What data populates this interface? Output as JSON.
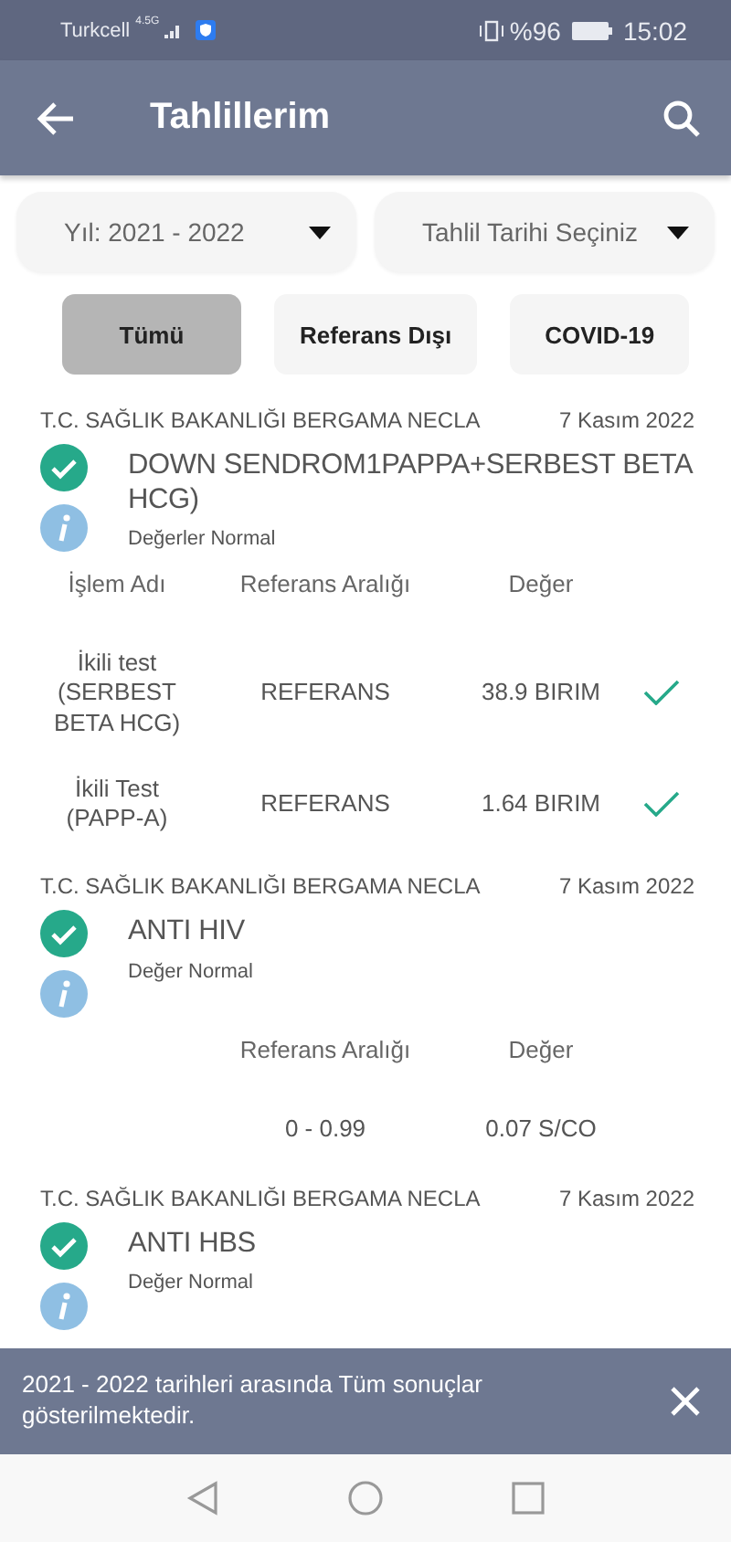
{
  "status_bar": {
    "carrier": "Turkcell",
    "network": "4.5G",
    "battery": "%96",
    "time": "15:02"
  },
  "app_bar": {
    "title": "Tahlillerim"
  },
  "filters": [
    {
      "label": "Yıl: 2021 - 2022"
    },
    {
      "label": "Tahlil Tarihi Seçiniz"
    }
  ],
  "tabs": [
    {
      "label": "Tümü",
      "selected": true
    },
    {
      "label": "Referans Dışı",
      "selected": false
    },
    {
      "label": "COVID-19",
      "selected": false
    }
  ],
  "results": [
    {
      "source": "T.C. SAĞLIK BAKANLIĞI BERGAMA NECLA",
      "date": "7 Kasım 2022",
      "title": "DOWN SENDROM1PAPPA+SERBEST BETA HCG)",
      "status": "Değerler Normal",
      "ok": true,
      "columns": {
        "name": "İşlem Adı",
        "reference": "Referans Aralığı",
        "value": "Değer"
      },
      "rows": [
        {
          "name": "İkili test (SERBEST BETA HCG)",
          "reference": "REFERANS",
          "value": "38.9 BIRIM",
          "ok": true
        },
        {
          "name": "İkili Test (PAPP-A)",
          "reference": "REFERANS",
          "value": "1.64 BIRIM",
          "ok": true
        }
      ]
    },
    {
      "source": "T.C. SAĞLIK BAKANLIĞI BERGAMA NECLA",
      "date": "7 Kasım 2022",
      "title": "ANTI HIV",
      "status": "Değer Normal",
      "ok": true,
      "columns": {
        "reference": "Referans Aralığı",
        "value": "Değer"
      },
      "rows": [
        {
          "reference": "0 - 0.99",
          "value": "0.07 S/CO"
        }
      ]
    },
    {
      "source": "T.C. SAĞLIK BAKANLIĞI BERGAMA NECLA",
      "date": "7 Kasım 2022",
      "title": "ANTI HBS",
      "status": "Değer Normal",
      "ok": true
    }
  ],
  "snackbar": {
    "message": "2021 - 2022 tarihleri arasında Tüm sonuçlar gösterilmektedir."
  }
}
